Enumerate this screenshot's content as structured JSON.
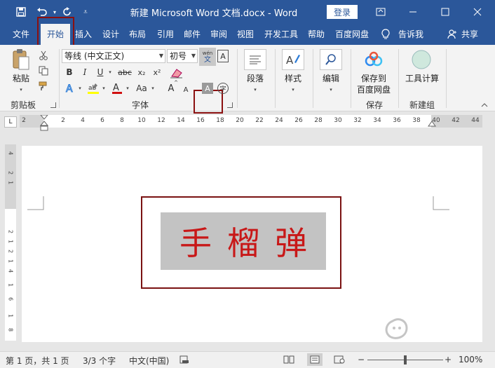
{
  "window": {
    "title": "新建 Microsoft Word 文档.docx  -  Word",
    "login_label": "登录",
    "controls": [
      "ribbon-options",
      "minimize",
      "maximize",
      "close"
    ]
  },
  "tabs": [
    {
      "label": "文件"
    },
    {
      "label": "开始",
      "active": true
    },
    {
      "label": "插入"
    },
    {
      "label": "设计"
    },
    {
      "label": "布局"
    },
    {
      "label": "引用"
    },
    {
      "label": "邮件"
    },
    {
      "label": "审阅"
    },
    {
      "label": "视图"
    },
    {
      "label": "开发工具"
    },
    {
      "label": "帮助"
    },
    {
      "label": "百度网盘"
    },
    {
      "label": "告诉我"
    },
    {
      "label": "共享"
    }
  ],
  "ribbon": {
    "clipboard": {
      "paste_label": "粘贴",
      "group_label": "剪贴板"
    },
    "font": {
      "font_name": "等线 (中文正文)",
      "font_size": "初号",
      "group_label": "字体",
      "phonetic_top": "wén",
      "phonetic_bottom": "文",
      "bold": "B",
      "italic": "I",
      "underline": "U",
      "strike": "abc",
      "subscript": "x₂",
      "superscript": "x²",
      "change_case": "Aa",
      "grow": "A",
      "shrink": "A",
      "char_shading": "A",
      "enclose": "字",
      "border": "A"
    },
    "paragraph": {
      "label": "段落"
    },
    "styles": {
      "label": "样式"
    },
    "editing": {
      "label": "编辑"
    },
    "save": {
      "label_line1": "保存到",
      "label_line2": "百度网盘",
      "group_label": "保存"
    },
    "tools": {
      "label": "工具计算",
      "group_label": "新建组"
    }
  },
  "ruler": {
    "corner": "L",
    "h_ticks": [
      "2",
      "2",
      "4",
      "6",
      "8",
      "10",
      "12",
      "14",
      "16",
      "18",
      "20",
      "22",
      "24",
      "26",
      "28",
      "30",
      "32",
      "34",
      "36",
      "38",
      "40",
      "42",
      "44"
    ],
    "v_ticks": [
      "4",
      "2",
      "1",
      "2",
      "1",
      "2",
      "1",
      "4",
      "1",
      "6",
      "1",
      "8"
    ]
  },
  "document": {
    "text": "手榴弹"
  },
  "status": {
    "page": "第 1 页，共 1 页",
    "words": "3/3 个字",
    "language": "中文(中国)",
    "zoom": "100%",
    "zoom_minus": "−",
    "zoom_plus": "+"
  },
  "colors": {
    "brand": "#2b579a",
    "highlight_box": "#8b1010",
    "text_color": "#c81818",
    "shading": "#c3c3c3"
  }
}
